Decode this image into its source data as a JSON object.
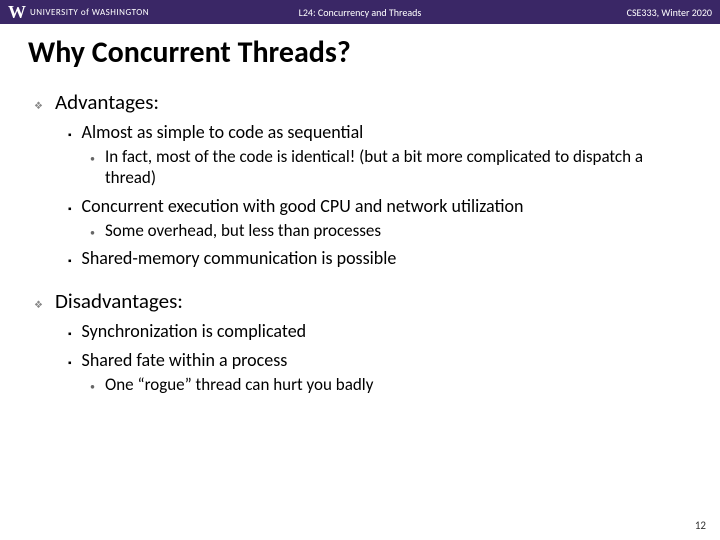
{
  "header": {
    "university": "UNIVERSITY of WASHINGTON",
    "lecture": "L24:  Concurrency and Threads",
    "course": "CSE333, Winter 2020"
  },
  "title": "Why Concurrent Threads?",
  "sections": [
    {
      "heading": "Advantages:",
      "items": [
        {
          "text": "Almost as simple to code as sequential",
          "subitems": [
            "In fact, most of the code is identical!  (but a bit more complicated to dispatch a thread)"
          ]
        },
        {
          "text": "Concurrent execution with good CPU and network utilization",
          "subitems": [
            "Some overhead, but less than processes"
          ]
        },
        {
          "text": "Shared-memory communication is possible",
          "subitems": []
        }
      ]
    },
    {
      "heading": "Disadvantages:",
      "items": [
        {
          "text": "Synchronization is complicated",
          "subitems": []
        },
        {
          "text": "Shared fate within a process",
          "subitems": [
            "One “rogue” thread can hurt you badly"
          ]
        }
      ]
    }
  ],
  "page_number": "12"
}
